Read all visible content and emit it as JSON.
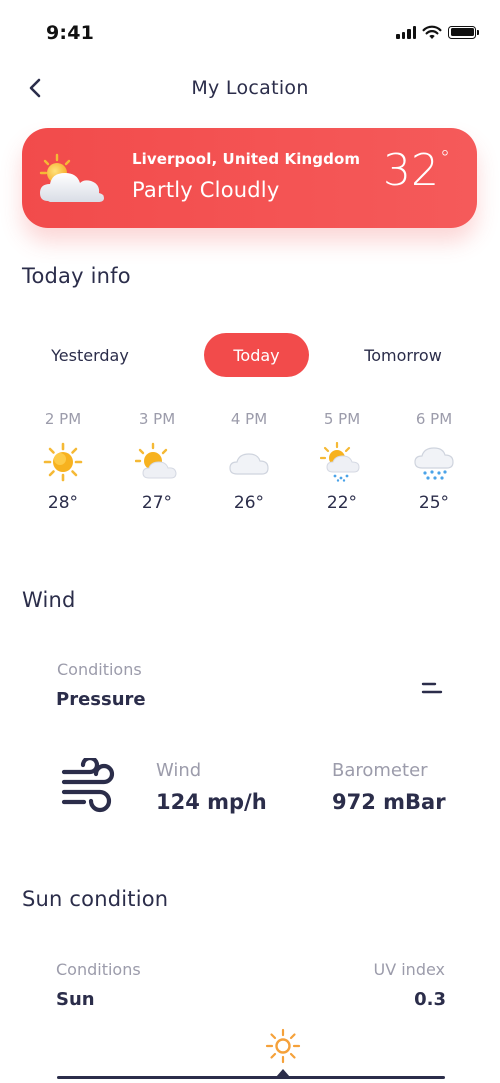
{
  "status_bar": {
    "time": "9:41"
  },
  "header": {
    "title": "My Location"
  },
  "location_card": {
    "city": "Liverpool, United Kingdom",
    "condition": "Partly Cloudly",
    "temperature": "32",
    "degree_symbol": "°",
    "icon": "partly-cloudy-icon"
  },
  "today_info": {
    "title": "Today info",
    "tabs": [
      {
        "label": "Yesterday",
        "selected": false
      },
      {
        "label": "Today",
        "selected": true
      },
      {
        "label": "Tomorrow",
        "selected": false
      }
    ],
    "hours": [
      {
        "time": "2 PM",
        "temp": "28°",
        "icon": "sun-icon"
      },
      {
        "time": "3 PM",
        "temp": "27°",
        "icon": "partly-cloudy-icon"
      },
      {
        "time": "4 PM",
        "temp": "26°",
        "icon": "cloud-icon"
      },
      {
        "time": "5 PM",
        "temp": "22°",
        "icon": "sun-rain-icon"
      },
      {
        "time": "6 PM",
        "temp": "25°",
        "icon": "snow-cloud-icon"
      }
    ]
  },
  "wind": {
    "title": "Wind",
    "conditions_label": "Conditions",
    "conditions_value": "Pressure",
    "wind_label": "Wind",
    "wind_value": "124 mp/h",
    "barometer_label": "Barometer",
    "barometer_value": "972 mBar"
  },
  "sun_condition": {
    "title": "Sun condition",
    "conditions_label": "Conditions",
    "conditions_value": "Sun",
    "uv_label": "UV index",
    "uv_value": "0.3"
  },
  "colors": {
    "accent": "#f24b4b",
    "text_dark": "#2b2d4a",
    "text_muted": "#9c9cab",
    "sun_orange": "#f5a13a"
  }
}
